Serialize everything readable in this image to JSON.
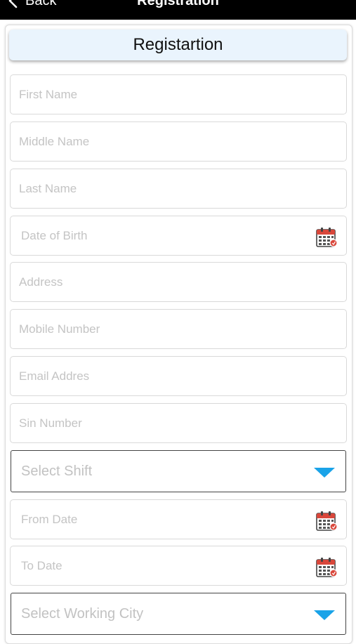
{
  "nav": {
    "back_label": "Back",
    "title": "Registration"
  },
  "form": {
    "header_title": "Registartion",
    "first_name_placeholder": "First Name",
    "middle_name_placeholder": "Middle Name",
    "last_name_placeholder": "Last Name",
    "dob_placeholder": "Date of Birth",
    "address_placeholder": "Address",
    "mobile_placeholder": "Mobile Number",
    "email_placeholder": "Email Addres",
    "sin_placeholder": "Sin Number",
    "shift_select": "Select Shift",
    "from_date_placeholder": "From Date",
    "to_date_placeholder": "To Date",
    "city_select": "Select Working City"
  },
  "icons": {
    "back": "chevron-left-icon",
    "calendar": "calendar-icon",
    "dropdown": "triangle-down-icon"
  },
  "colors": {
    "navbar": "#000000",
    "header_card": "#eaf4fd",
    "dropdown_caret": "#1aa3e8",
    "calendar_top": "#d9473b"
  }
}
